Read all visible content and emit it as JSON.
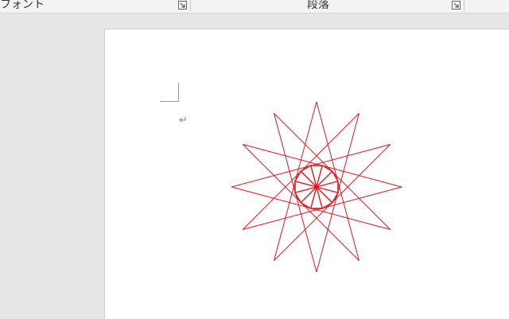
{
  "ribbon": {
    "groups": [
      {
        "label": "フォント"
      },
      {
        "label": "段落"
      }
    ]
  },
  "document": {
    "paragraph_mark": "↵"
  },
  "shape": {
    "stroke_color": "#e8141b",
    "inner_color": "#e8141b",
    "icon": "twelve-point-star-shape"
  }
}
